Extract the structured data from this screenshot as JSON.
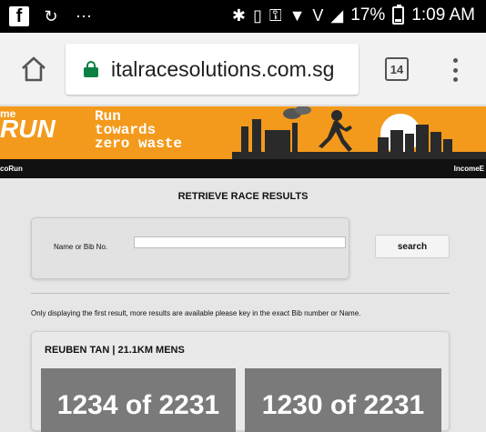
{
  "status_bar": {
    "battery": "17%",
    "time": "1:09 AM",
    "network_label": "V"
  },
  "browser": {
    "url": "italracesolutions.com.sg",
    "tab_count": "14"
  },
  "banner": {
    "brand_top": "me",
    "brand_main": "RUN",
    "tagline_lines": [
      "Run",
      "towards",
      "zero waste"
    ],
    "footer_left": "coRun",
    "footer_right": "IncomeE"
  },
  "page": {
    "heading": "RETRIEVE RACE RESULTS",
    "search_label": "Name or Bib No.",
    "search_value": "",
    "search_button": "search",
    "notice": "Only displaying the first result, more results are available please key in the exact Bib number or Name.",
    "result_title": "REUBEN TAN | 21.1KM MENS",
    "stats": [
      "1234 of 2231",
      "1230 of 2231"
    ]
  },
  "colors": {
    "banner_orange": "#f39a1c",
    "lock_green": "#0b8043",
    "stat_gray": "#7a7a7a"
  }
}
